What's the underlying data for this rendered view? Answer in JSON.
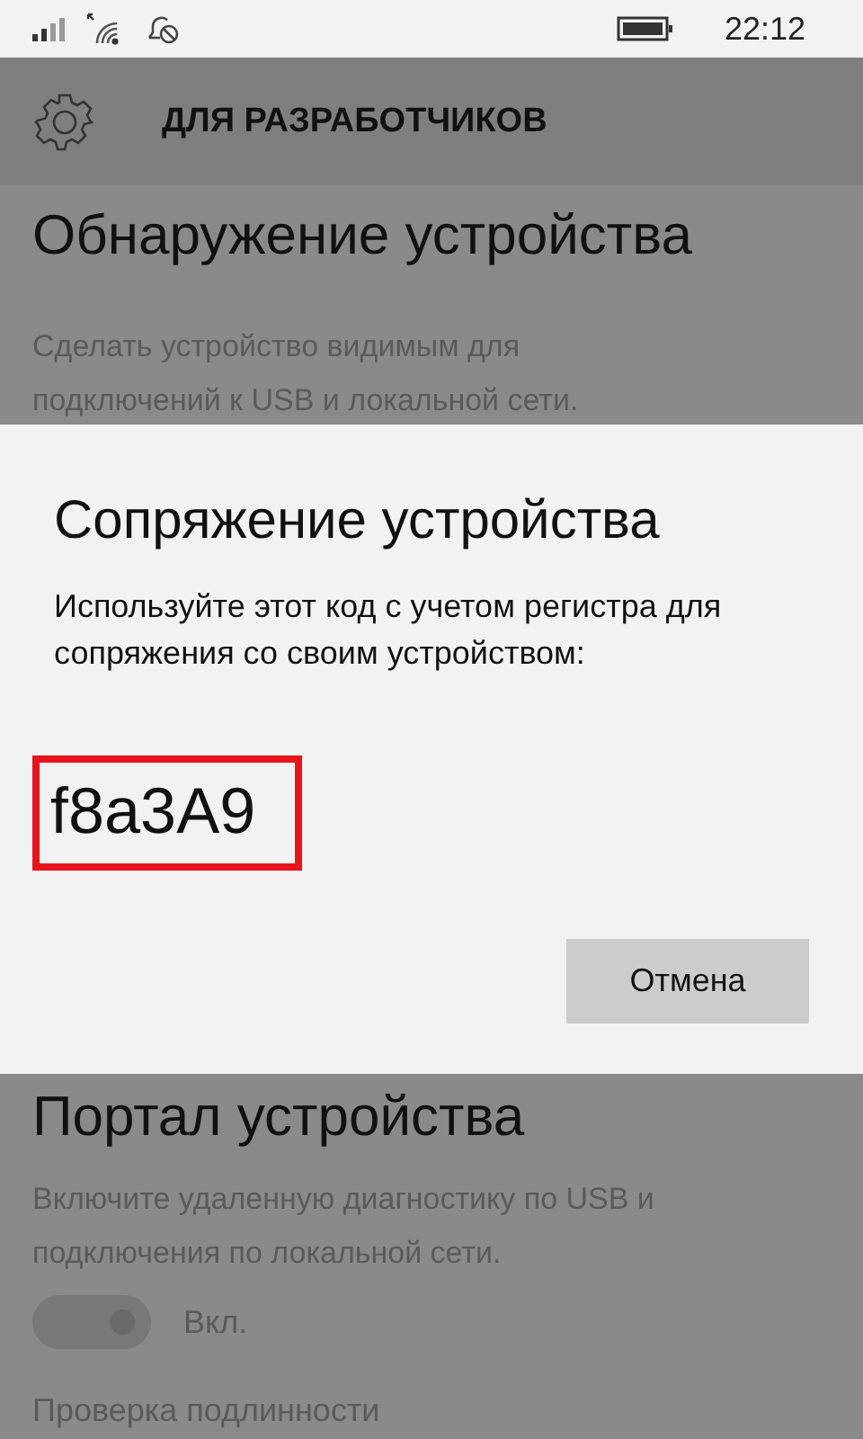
{
  "status_bar": {
    "time": "22:12"
  },
  "header": {
    "title": "ДЛЯ РАЗРАБОТЧИКОВ"
  },
  "sections": [
    {
      "title": "Обнаружение устройства",
      "description": "Сделать устройство видимым для подключений к USB и локальной сети."
    },
    {
      "title": "Портал устройства",
      "description": "Включите удаленную диагностику по USB и подключения по локальной сети.",
      "toggle": {
        "on": true,
        "label": "Вкл."
      },
      "subtitle": "Проверка подлинности"
    }
  ],
  "dialog": {
    "title": "Сопряжение устройства",
    "message": "Используйте этот код с учетом регистра для сопряжения со своим устройством:",
    "code": "f8a3A9",
    "buttons": [
      "Отмена"
    ]
  }
}
